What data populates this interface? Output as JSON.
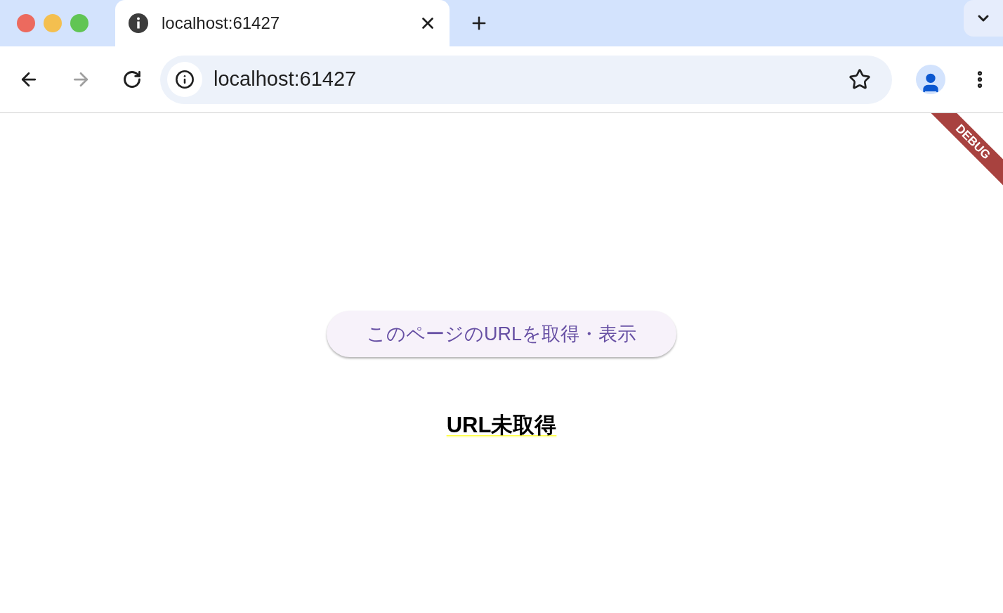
{
  "browser": {
    "tabs": [
      {
        "title": "localhost:61427",
        "selected": true
      }
    ],
    "address": "localhost:61427"
  },
  "page": {
    "debug_banner": "DEBUG",
    "button": "このページのURLを取得・表示",
    "status": "URL未取得"
  }
}
